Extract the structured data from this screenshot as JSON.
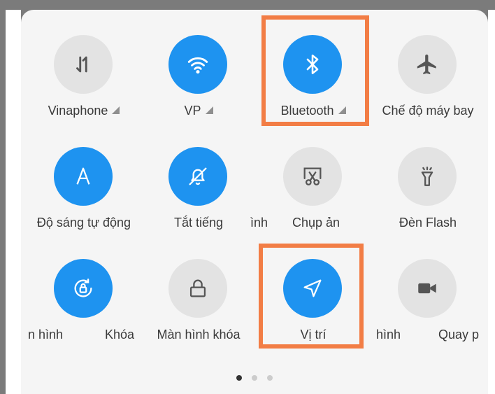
{
  "tiles": {
    "vinaphone": {
      "label": "Vinaphone",
      "icon": "mobile-data-icon",
      "active": false
    },
    "vp": {
      "label": "VP",
      "icon": "wifi-icon",
      "active": true
    },
    "bluetooth": {
      "label": "Bluetooth",
      "icon": "bluetooth-icon",
      "active": true
    },
    "airplane": {
      "label": "Chế độ máy bay",
      "icon": "airplane-icon",
      "active": false
    },
    "auto_brightness": {
      "label": "Độ sáng tự động",
      "icon": "auto-brightness-icon",
      "active": true
    },
    "silent": {
      "label": "Tắt tiếng",
      "icon": "bell-off-icon",
      "active": true
    },
    "screenshot": {
      "label": "Chụp ản",
      "label_prefix": "ình",
      "icon": "screenshot-icon",
      "active": false
    },
    "flashlight": {
      "label": "Đèn Flash",
      "icon": "flashlight-icon",
      "active": false
    },
    "rotation_lock": {
      "label": "Khóa",
      "label_prefix": "n hình",
      "icon": "rotation-lock-icon",
      "active": true
    },
    "lock_screen": {
      "label": "Màn hình khóa",
      "icon": "lock-icon",
      "active": false
    },
    "location": {
      "label": "Vị trí",
      "icon": "location-icon",
      "active": true
    },
    "screen_record": {
      "label": "Quay p",
      "label_prefix": "hình",
      "icon": "video-camera-icon",
      "active": false
    }
  },
  "pager": {
    "total_pages": 3,
    "current_page": 1
  },
  "colors": {
    "accent": "#1e93f0",
    "inactive": "#e3e3e3",
    "highlight": "#f27d45"
  }
}
